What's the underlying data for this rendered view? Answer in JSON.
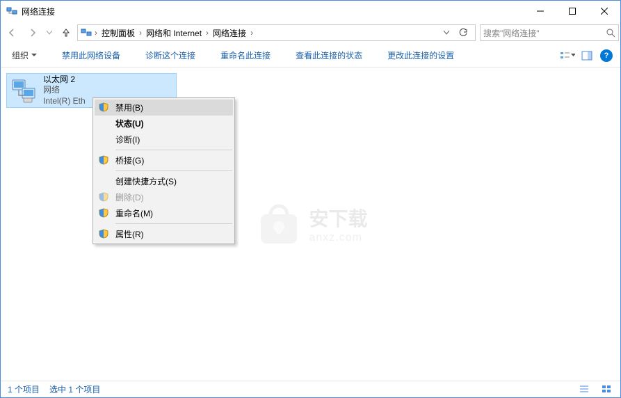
{
  "window": {
    "title": "网络连接"
  },
  "breadcrumbs": {
    "c1": "控制面板",
    "c2": "网络和 Internet",
    "c3": "网络连接"
  },
  "search": {
    "placeholder": "搜索\"网络连接\""
  },
  "toolbar": {
    "organize": "组织",
    "b1": "禁用此网络设备",
    "b2": "诊断这个连接",
    "b3": "重命名此连接",
    "b4": "查看此连接的状态",
    "b5": "更改此连接的设置"
  },
  "adapter": {
    "name": "以太网 2",
    "status": "网络",
    "device": "Intel(R) Eth"
  },
  "contextmenu": {
    "disable": "禁用(B)",
    "status": "状态(U)",
    "diagnose": "诊断(I)",
    "bridge": "桥接(G)",
    "shortcut": "创建快捷方式(S)",
    "delete": "删除(D)",
    "rename": "重命名(M)",
    "properties": "属性(R)"
  },
  "watermark": {
    "t1": "安下载",
    "t2": "anxz.com"
  },
  "statusbar": {
    "count": "1 个项目",
    "selected": "选中 1 个项目"
  }
}
